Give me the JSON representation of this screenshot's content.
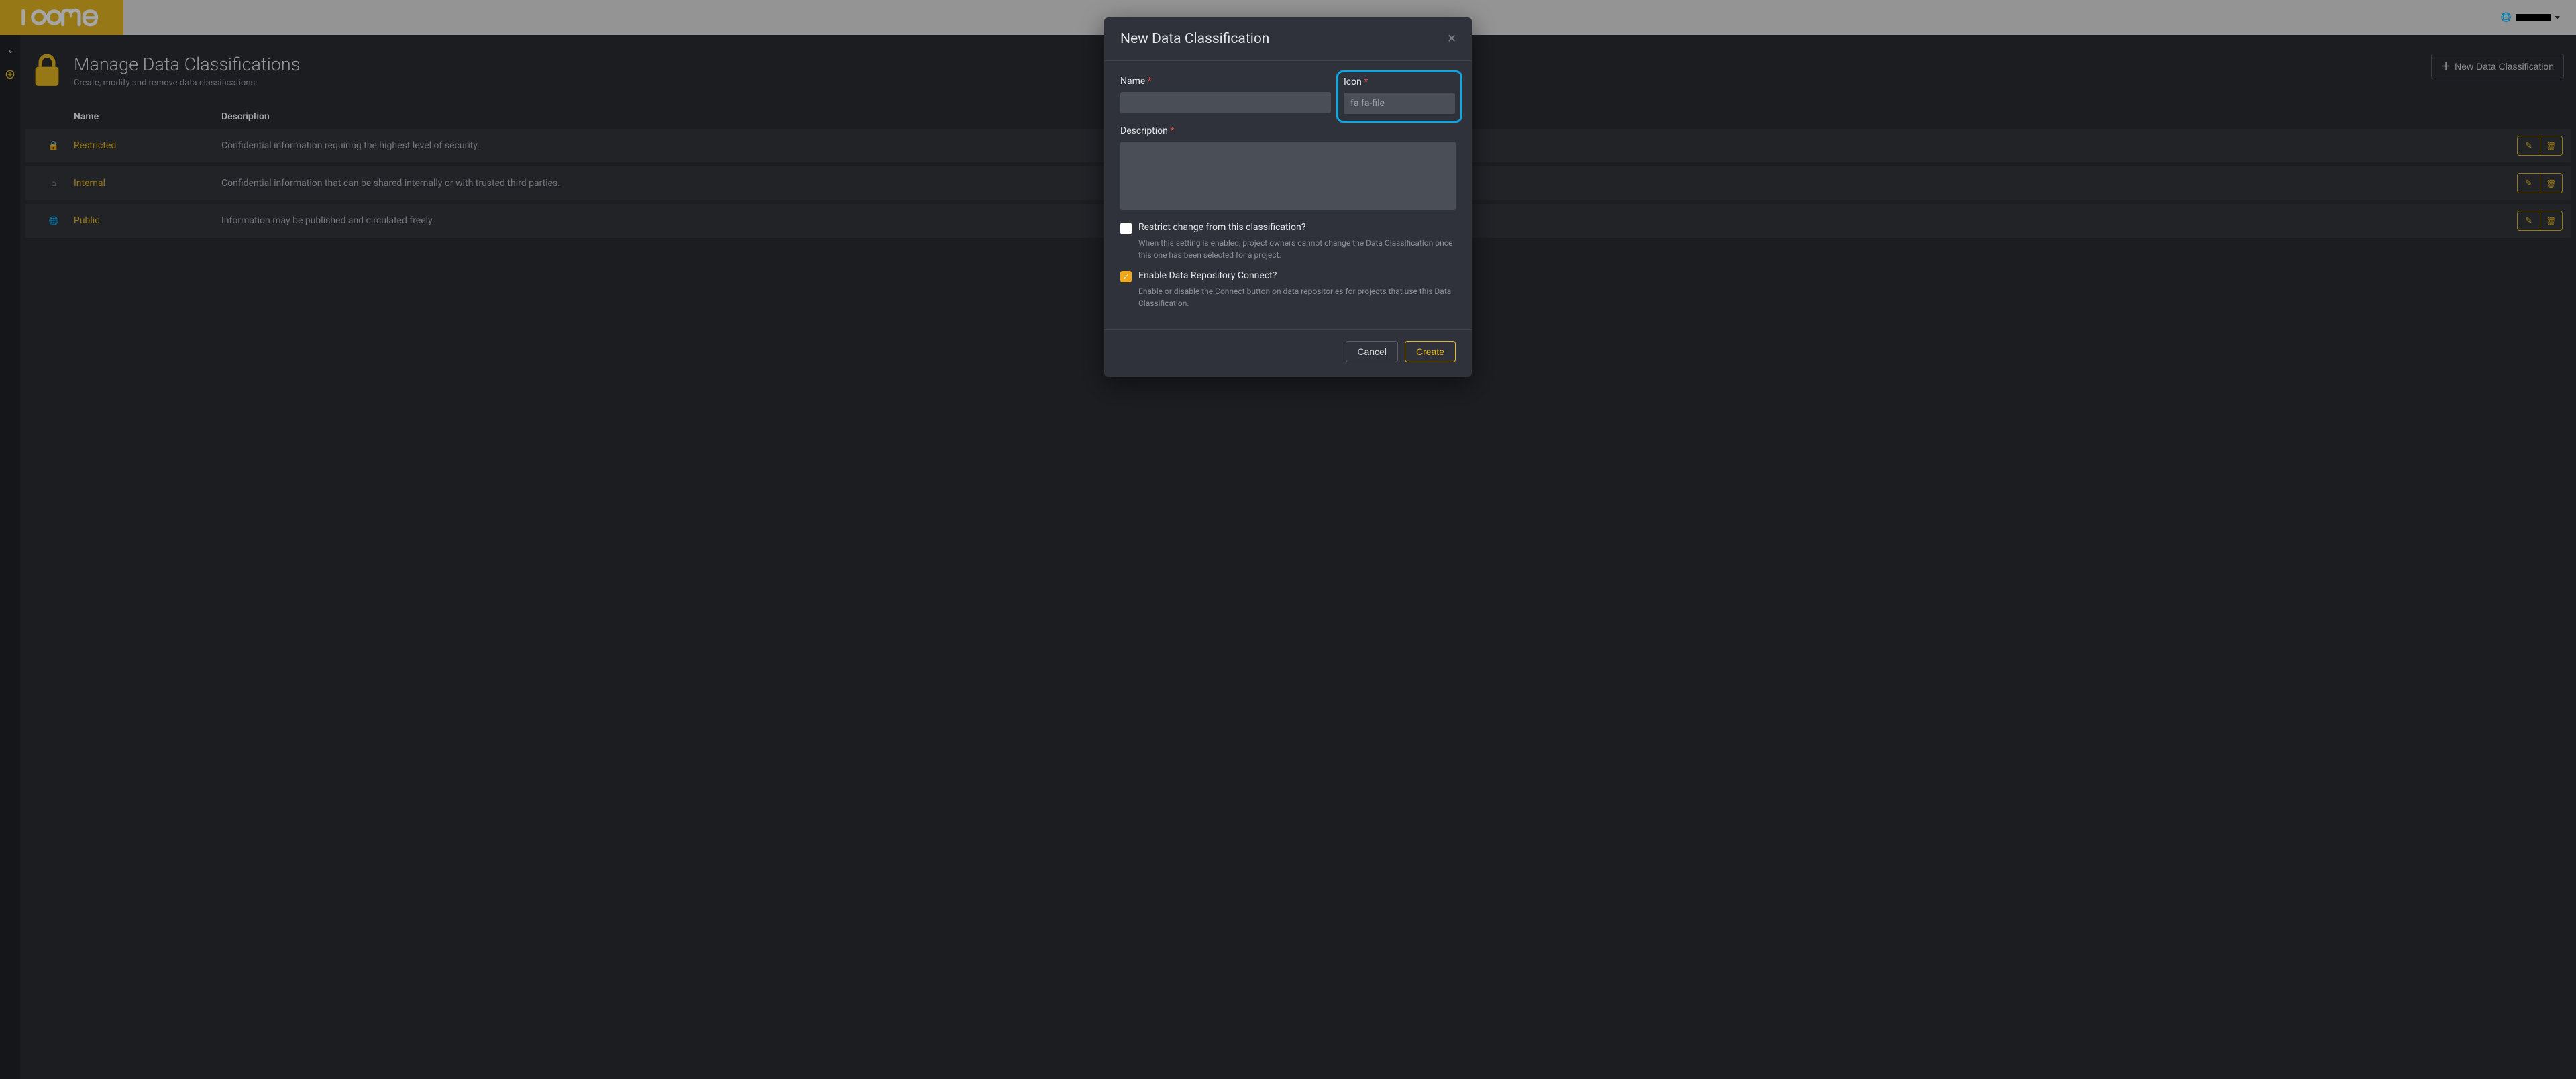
{
  "brand": {
    "name": "loome",
    "accent": "#e8b923"
  },
  "header": {
    "user_dropdown": {
      "label": ""
    }
  },
  "sidebar": {
    "toggle_tooltip": "Expand",
    "add_tooltip": "Add"
  },
  "page": {
    "title": "Manage Data Classifications",
    "subtitle": "Create, modify and remove data classifications.",
    "new_button_label": "New Data Classification"
  },
  "table": {
    "columns": {
      "icon": "",
      "name": "Name",
      "description": "Description",
      "actions": ""
    },
    "rows": [
      {
        "icon": "lock",
        "name": "Restricted",
        "description": "Confidential information requiring the highest level of security."
      },
      {
        "icon": "home",
        "name": "Internal",
        "description": "Confidential information that can be shared internally or with trusted third parties."
      },
      {
        "icon": "globe",
        "name": "Public",
        "description": "Information may be published and circulated freely."
      }
    ],
    "row_actions": {
      "edit": "Edit",
      "delete": "Delete"
    }
  },
  "modal": {
    "title": "New Data Classification",
    "close_label": "Close",
    "fields": {
      "name": {
        "label": "Name",
        "required": true,
        "value": "",
        "placeholder": ""
      },
      "icon": {
        "label": "Icon",
        "required": true,
        "value": "",
        "placeholder": "fa fa-file"
      },
      "description": {
        "label": "Description",
        "required": true,
        "value": "",
        "placeholder": ""
      }
    },
    "checkboxes": {
      "restrict": {
        "label": "Restrict change from this classification?",
        "help": "When this setting is enabled, project owners cannot change the Data Classification once this one has been selected for a project.",
        "checked": false
      },
      "connect": {
        "label": "Enable Data Repository Connect?",
        "help": "Enable or disable the Connect button on data repositories for projects that use this Data Classification.",
        "checked": true
      }
    },
    "buttons": {
      "cancel": "Cancel",
      "create": "Create"
    }
  }
}
